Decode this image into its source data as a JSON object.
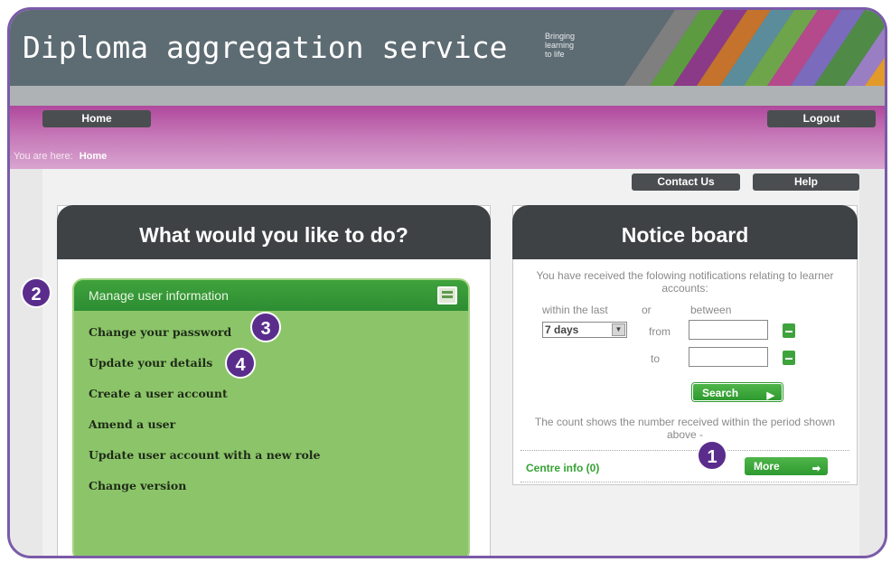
{
  "header": {
    "app_title": "Diploma aggregation service",
    "tagline": [
      "Bringing",
      "learning",
      "to life"
    ]
  },
  "nav": {
    "home_label": "Home",
    "logout_label": "Logout",
    "breadcrumb_prefix": "You are here:",
    "breadcrumb_current": "Home",
    "contact_label": "Contact Us",
    "help_label": "Help"
  },
  "left_panel": {
    "title": "What would you like to do?",
    "section_title": "Manage user information",
    "links": [
      "Change your password",
      "Update your details",
      "Create a user account",
      "Amend a user",
      "Update user account with a new role",
      "Change version"
    ]
  },
  "notice_board": {
    "title": "Notice board",
    "intro": "You have received the folowing notifications relating to learner accounts:",
    "within_label": "within the last",
    "or_label": "or",
    "between_label": "between",
    "period_value": "7 days",
    "from_label": "from",
    "to_label": "to",
    "search_label": "Search",
    "count_note": "The count shows the number received within the period shown above -",
    "centre_info": "Centre info (0)",
    "more_label": "More"
  },
  "callouts": [
    "1",
    "2",
    "3",
    "4"
  ],
  "colors": {
    "header_bg": "#5d6b72",
    "nav_band": "#b0489c",
    "callout": "#5a2d8c",
    "green_panel": "#8cc569",
    "green_button": "#36a335"
  }
}
